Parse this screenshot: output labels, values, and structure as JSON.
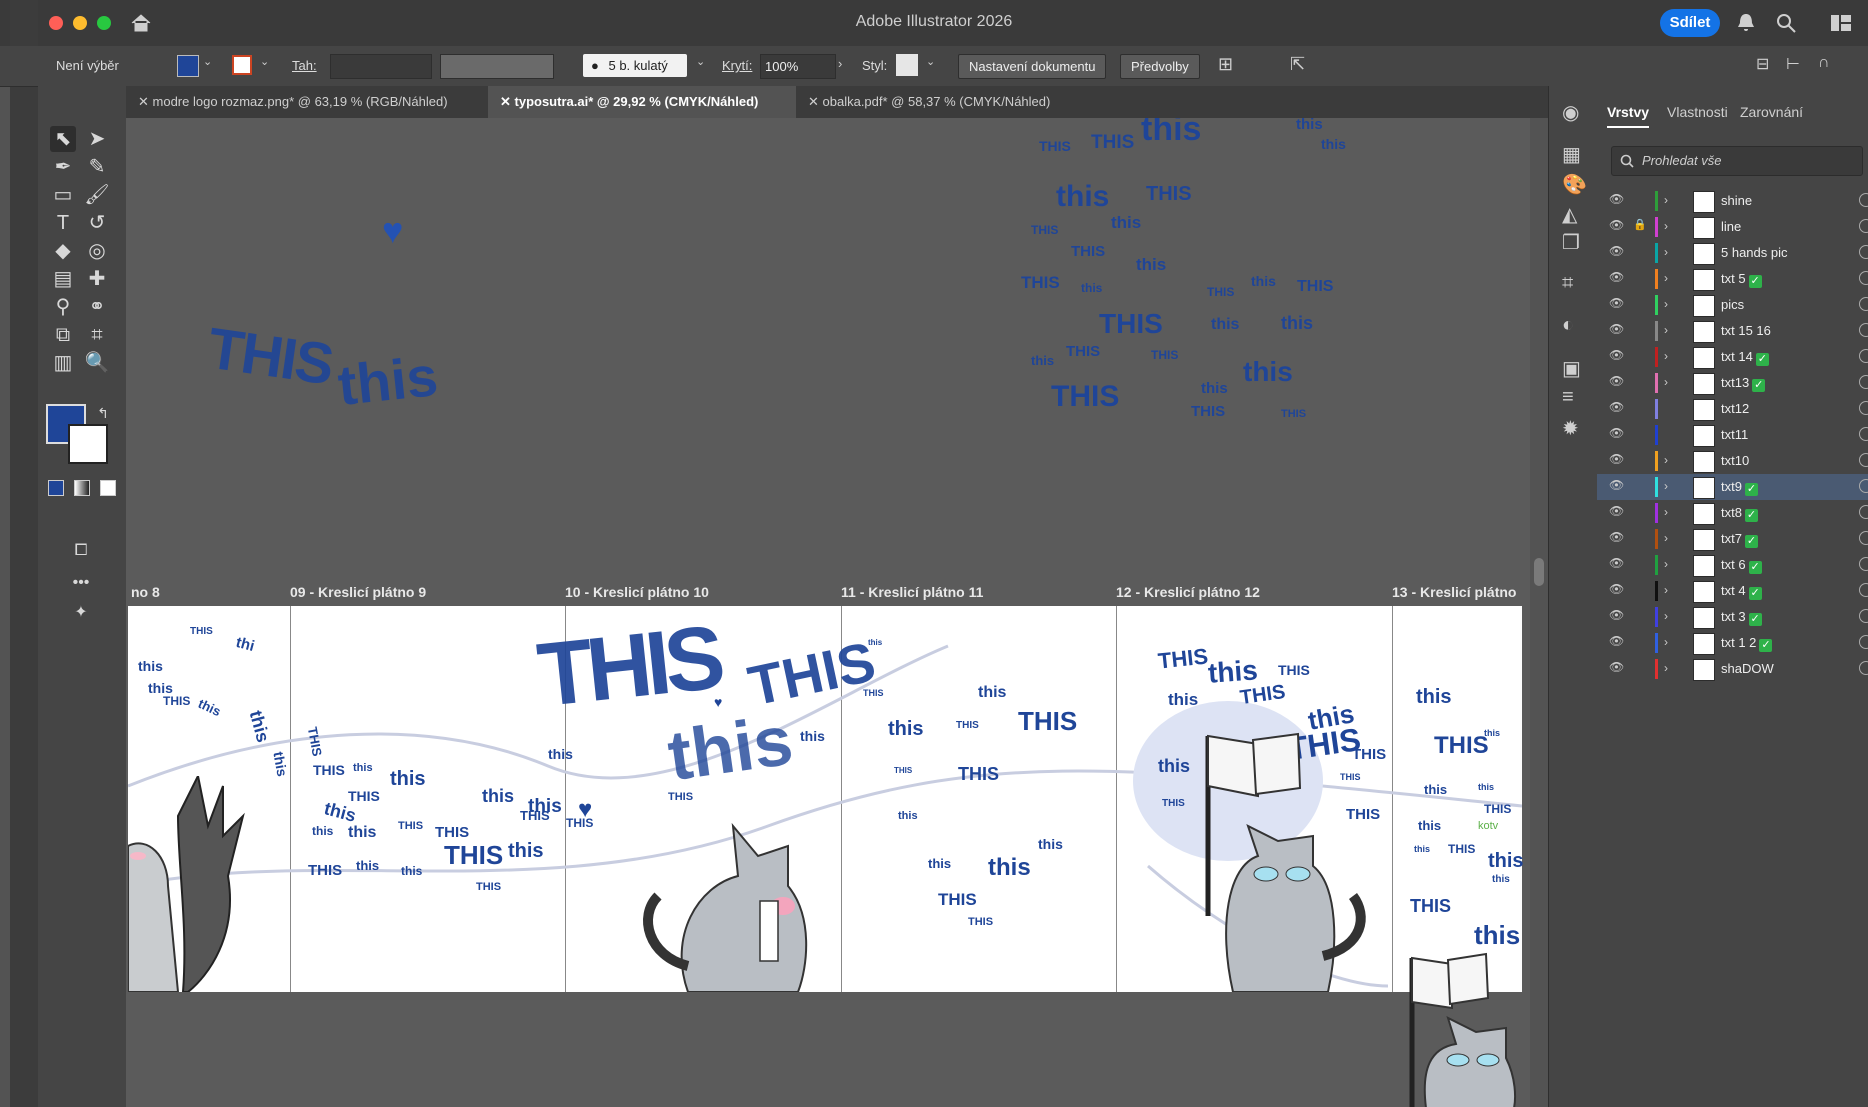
{
  "window": {
    "title": "Adobe Illustrator 2026",
    "share_label": "Sdílet"
  },
  "control_bar": {
    "selection_status": "Není výběr",
    "stroke_label": "Tah:",
    "brush_label": "5 b. kulatý",
    "opacity_label": "Krytí:",
    "opacity_value": "100%",
    "style_label": "Styl:",
    "doc_setup_label": "Nastavení dokumentu",
    "prefs_label": "Předvolby"
  },
  "tabs": [
    {
      "label": "modre logo rozmaz.png* @ 63,19 % (RGB/Náhled)",
      "active": false
    },
    {
      "label": "typosutra.ai* @ 29,92 % (CMYK/Náhled)",
      "active": true
    },
    {
      "label": "obalka.pdf* @ 58,37 % (CMYK/Náhled)",
      "active": false
    }
  ],
  "panel": {
    "tabs": [
      "Vrstvy",
      "Vlastnosti",
      "Zarovnání"
    ],
    "search_placeholder": "Prohledat vše",
    "layers": [
      {
        "name": "shine",
        "color": "#2e9e3a",
        "checked": false,
        "locked": false,
        "selected": false,
        "expandable": true
      },
      {
        "name": "line",
        "color": "#d040d0",
        "checked": false,
        "locked": true,
        "selected": false,
        "expandable": true
      },
      {
        "name": "5 hands pic",
        "color": "#0aa5a5",
        "checked": false,
        "locked": false,
        "selected": false,
        "expandable": true
      },
      {
        "name": "txt 5",
        "color": "#f08020",
        "checked": true,
        "locked": false,
        "selected": false,
        "expandable": true
      },
      {
        "name": "pics",
        "color": "#30d060",
        "checked": false,
        "locked": false,
        "selected": false,
        "expandable": true
      },
      {
        "name": "txt 15 16",
        "color": "#888888",
        "checked": false,
        "locked": false,
        "selected": false,
        "expandable": true
      },
      {
        "name": "txt 14",
        "color": "#c02020",
        "checked": true,
        "locked": false,
        "selected": false,
        "expandable": true
      },
      {
        "name": "txt13",
        "color": "#e070b0",
        "checked": true,
        "locked": false,
        "selected": false,
        "expandable": true
      },
      {
        "name": "txt12",
        "color": "#8080e0",
        "checked": false,
        "locked": false,
        "selected": false,
        "expandable": false
      },
      {
        "name": "txt11",
        "color": "#2040d0",
        "checked": false,
        "locked": false,
        "selected": false,
        "expandable": false
      },
      {
        "name": "txt10",
        "color": "#f0a020",
        "checked": false,
        "locked": false,
        "selected": false,
        "expandable": true
      },
      {
        "name": "txt9",
        "color": "#30e0e0",
        "checked": true,
        "locked": false,
        "selected": true,
        "expandable": true
      },
      {
        "name": "txt8",
        "color": "#a030e0",
        "checked": true,
        "locked": false,
        "selected": false,
        "expandable": true
      },
      {
        "name": "txt7",
        "color": "#b05010",
        "checked": true,
        "locked": false,
        "selected": false,
        "expandable": true
      },
      {
        "name": "txt 6",
        "color": "#20a040",
        "checked": true,
        "locked": false,
        "selected": false,
        "expandable": true
      },
      {
        "name": "txt 4",
        "color": "#101010",
        "checked": true,
        "locked": false,
        "selected": false,
        "expandable": true
      },
      {
        "name": "txt 3",
        "color": "#4040e0",
        "checked": true,
        "locked": false,
        "selected": false,
        "expandable": true
      },
      {
        "name": "txt 1 2",
        "color": "#3060e0",
        "checked": true,
        "locked": false,
        "selected": false,
        "expandable": true
      },
      {
        "name": "shaDOW",
        "color": "#e03030",
        "checked": false,
        "locked": false,
        "selected": false,
        "expandable": true
      }
    ]
  },
  "artboards": [
    "no 8",
    "09 - Kreslicí plátno 9",
    "10 - Kreslicí plátno 10",
    "11 - Kreslicí plátno 11",
    "12 - Kreslicí plátno 12",
    "13 - Kreslicí plátno"
  ],
  "art_text": {
    "upper": "THIS",
    "lower": "this",
    "partial": "thi",
    "green": "kotv"
  },
  "colors": {
    "fill": "#1f4598",
    "accent": "#1473e6",
    "art_blue": "#1f4598"
  }
}
